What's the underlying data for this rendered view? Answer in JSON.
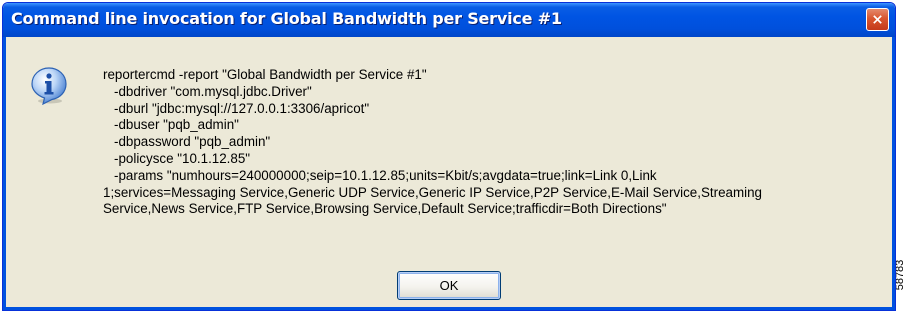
{
  "dialog": {
    "title": "Command line invocation for Global Bandwidth per Service #1",
    "icon": "info-icon",
    "close_icon": "close-icon",
    "message_lines": [
      "reportercmd -report \"Global Bandwidth per Service #1\"",
      "-dbdriver \"com.mysql.jdbc.Driver\"",
      "-dburl \"jdbc:mysql://127.0.0.1:3306/apricot\"",
      "-dbuser \"pqb_admin\"",
      "-dbpassword \"pqb_admin\"",
      "-policysce \"10.1.12.85\"",
      "-params \"numhours=240000000;seip=10.1.12.85;units=Kbit/s;avgdata=true;link=Link 0,Link",
      "1;services=Messaging Service,Generic UDP Service,Generic IP Service,P2P Service,E-Mail Service,Streaming",
      "Service,News Service,FTP Service,Browsing Service,Default Service;trafficdir=Both Directions\""
    ],
    "ok_label": "OK"
  },
  "figure_id": "58783",
  "colors": {
    "titlebar": "#0054e3",
    "dialog_bg": "#ece9d8",
    "close_button": "#d9562f",
    "title_text": "#ffffff"
  }
}
